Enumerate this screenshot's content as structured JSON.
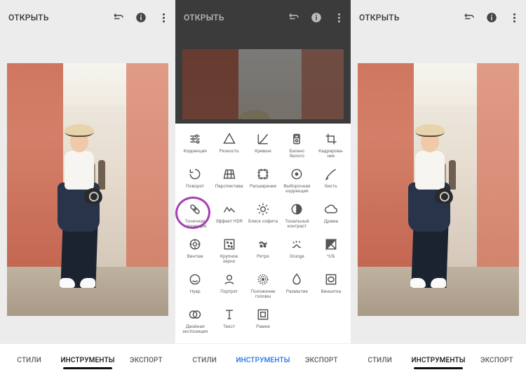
{
  "header": {
    "open_label": "ОТКРЫТЬ"
  },
  "tabs": {
    "styles": "СТИЛИ",
    "tools": "ИНСТРУМЕНТЫ",
    "export": "ЭКСПОРТ"
  },
  "tools": [
    {
      "id": "tune",
      "label": "Коррекция"
    },
    {
      "id": "details",
      "label": "Резкость"
    },
    {
      "id": "curves",
      "label": "Кривые"
    },
    {
      "id": "whitebal",
      "label": "Баланс белого"
    },
    {
      "id": "crop",
      "label": "Кадрирова-ние"
    },
    {
      "id": "rotate",
      "label": "Поворот"
    },
    {
      "id": "perspective",
      "label": "Перспектива"
    },
    {
      "id": "expand",
      "label": "Расширение"
    },
    {
      "id": "selective",
      "label": "Выборочная коррекция"
    },
    {
      "id": "brush",
      "label": "Кисть"
    },
    {
      "id": "healing",
      "label": "Точечная коррекция"
    },
    {
      "id": "hdr",
      "label": "Эффект HDR"
    },
    {
      "id": "glamour",
      "label": "Блеск софита"
    },
    {
      "id": "tonal",
      "label": "Тональный контраст"
    },
    {
      "id": "drama",
      "label": "Драма"
    },
    {
      "id": "vintage",
      "label": "Винтаж"
    },
    {
      "id": "grainy",
      "label": "Крупное зерно"
    },
    {
      "id": "retrolux",
      "label": "Ретро"
    },
    {
      "id": "grunge",
      "label": "Grunge"
    },
    {
      "id": "bw",
      "label": "Ч/Б"
    },
    {
      "id": "noir",
      "label": "Нуар"
    },
    {
      "id": "portrait",
      "label": "Портрет"
    },
    {
      "id": "headpose",
      "label": "Положение головы"
    },
    {
      "id": "blur",
      "label": "Размытие"
    },
    {
      "id": "vignette",
      "label": "Виньетка"
    },
    {
      "id": "double",
      "label": "Двойная экспозиция"
    },
    {
      "id": "text",
      "label": "Текст"
    },
    {
      "id": "frames",
      "label": "Рамки"
    }
  ],
  "highlighted_tool": "healing"
}
